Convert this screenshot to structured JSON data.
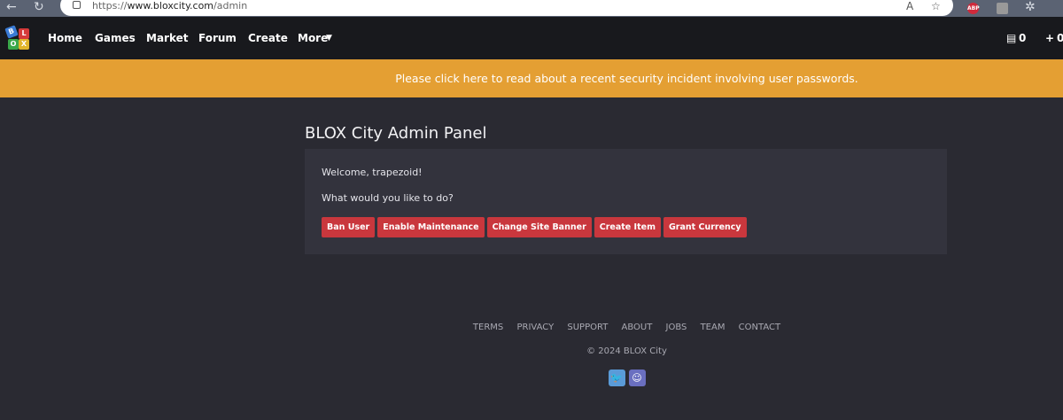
{
  "browser": {
    "url_prefix": "https://",
    "url_domain": "www.bloxcity.com",
    "url_path": "/admin",
    "ext_abp": "ABP"
  },
  "nav": {
    "logo_letters": [
      "B",
      "L",
      "O",
      "X"
    ],
    "items": [
      "Home",
      "Games",
      "Market",
      "Forum",
      "Create",
      "More"
    ],
    "messages_count": "0",
    "friends_count": "0"
  },
  "banner": {
    "text": "Please click here to read about a recent security incident involving user passwords."
  },
  "page": {
    "title": "BLOX City Admin Panel",
    "welcome": "Welcome, trapezoid!",
    "prompt": "What would you like to do?",
    "buttons": [
      "Ban User",
      "Enable Maintenance",
      "Change Site Banner",
      "Create Item",
      "Grant Currency"
    ]
  },
  "footer": {
    "links": [
      "TERMS",
      "PRIVACY",
      "SUPPORT",
      "ABOUT",
      "JOBS",
      "TEAM",
      "CONTACT"
    ],
    "copyright": "© 2024 BLOX City"
  }
}
